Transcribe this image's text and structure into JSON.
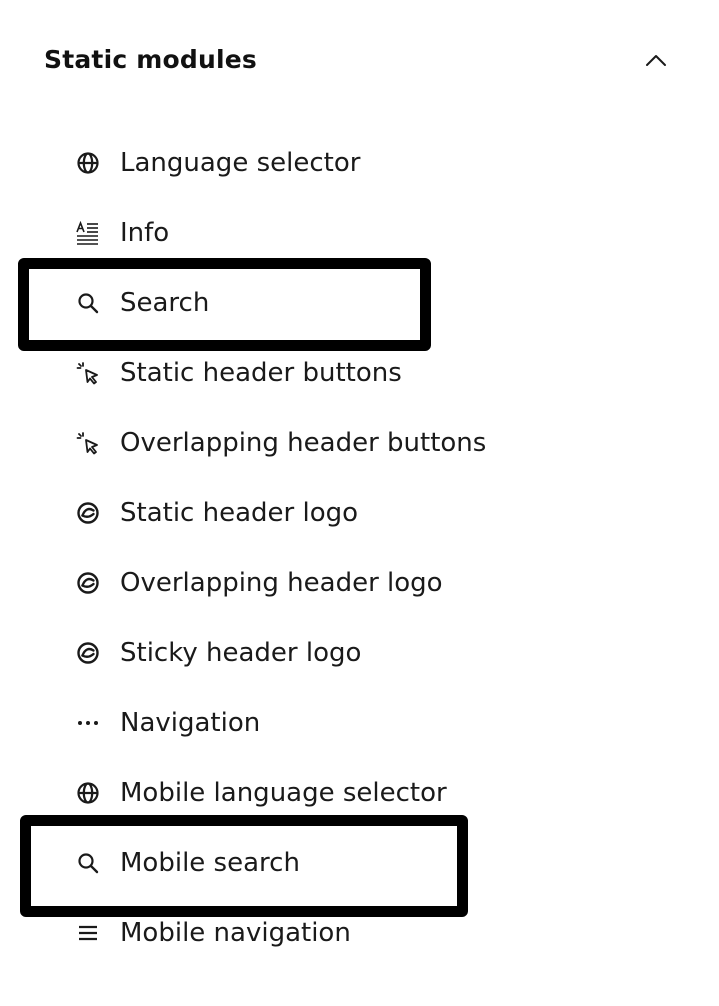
{
  "section": {
    "title": "Static modules",
    "toggle_icon": "chevron-up-icon"
  },
  "modules": [
    {
      "label": "Language selector",
      "icon": "globe-icon"
    },
    {
      "label": "Info",
      "icon": "text-info-icon"
    },
    {
      "label": "Search",
      "icon": "search-icon",
      "highlighted": true
    },
    {
      "label": "Static header buttons",
      "icon": "cursor-click-icon"
    },
    {
      "label": "Overlapping header buttons",
      "icon": "cursor-click-icon"
    },
    {
      "label": "Static header logo",
      "icon": "logo-icon"
    },
    {
      "label": "Overlapping header logo",
      "icon": "logo-icon"
    },
    {
      "label": "Sticky header logo",
      "icon": "logo-icon"
    },
    {
      "label": "Navigation",
      "icon": "more-dots-icon"
    },
    {
      "label": "Mobile language selector",
      "icon": "globe-icon"
    },
    {
      "label": "Mobile search",
      "icon": "search-icon",
      "highlighted": true
    },
    {
      "label": "Mobile navigation",
      "icon": "hamburger-menu-icon"
    }
  ],
  "colors": {
    "text": "#1a1a1a",
    "highlight_border": "#000000",
    "background": "#ffffff"
  }
}
